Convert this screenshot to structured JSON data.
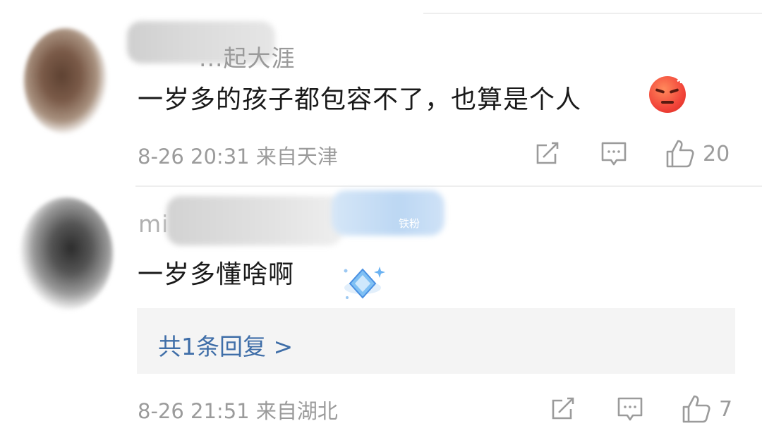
{
  "comments": [
    {
      "username": "...起大涯",
      "text": "一岁多的孩子都包容不了，也算是个人",
      "emoji": "angry-face-icon",
      "date": "8-26 20:31",
      "location": "来自天津",
      "like_count": "20"
    },
    {
      "username": "mi",
      "badge": "铁粉",
      "text": "一岁多懂啥啊",
      "sticker": "blue-diamond-sticker",
      "date": "8-26 21:51",
      "location": "来自湖北",
      "like_count": "7",
      "replies_label": "共1条回复 >"
    }
  ],
  "colors": {
    "link": "#3f6ea8",
    "meta": "#9b9b9b",
    "reply_bg": "#f4f4f4"
  }
}
